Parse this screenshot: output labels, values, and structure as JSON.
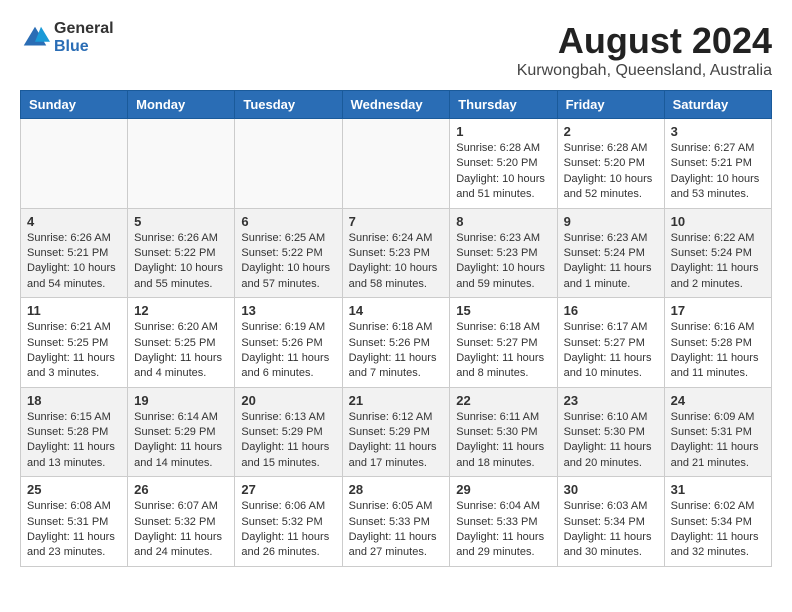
{
  "header": {
    "logo_general": "General",
    "logo_blue": "Blue",
    "main_title": "August 2024",
    "subtitle": "Kurwongbah, Queensland, Australia"
  },
  "days_of_week": [
    "Sunday",
    "Monday",
    "Tuesday",
    "Wednesday",
    "Thursday",
    "Friday",
    "Saturday"
  ],
  "weeks": [
    {
      "shade": false,
      "days": [
        {
          "num": "",
          "info": ""
        },
        {
          "num": "",
          "info": ""
        },
        {
          "num": "",
          "info": ""
        },
        {
          "num": "",
          "info": ""
        },
        {
          "num": "1",
          "info": "Sunrise: 6:28 AM\nSunset: 5:20 PM\nDaylight: 10 hours\nand 51 minutes."
        },
        {
          "num": "2",
          "info": "Sunrise: 6:28 AM\nSunset: 5:20 PM\nDaylight: 10 hours\nand 52 minutes."
        },
        {
          "num": "3",
          "info": "Sunrise: 6:27 AM\nSunset: 5:21 PM\nDaylight: 10 hours\nand 53 minutes."
        }
      ]
    },
    {
      "shade": true,
      "days": [
        {
          "num": "4",
          "info": "Sunrise: 6:26 AM\nSunset: 5:21 PM\nDaylight: 10 hours\nand 54 minutes."
        },
        {
          "num": "5",
          "info": "Sunrise: 6:26 AM\nSunset: 5:22 PM\nDaylight: 10 hours\nand 55 minutes."
        },
        {
          "num": "6",
          "info": "Sunrise: 6:25 AM\nSunset: 5:22 PM\nDaylight: 10 hours\nand 57 minutes."
        },
        {
          "num": "7",
          "info": "Sunrise: 6:24 AM\nSunset: 5:23 PM\nDaylight: 10 hours\nand 58 minutes."
        },
        {
          "num": "8",
          "info": "Sunrise: 6:23 AM\nSunset: 5:23 PM\nDaylight: 10 hours\nand 59 minutes."
        },
        {
          "num": "9",
          "info": "Sunrise: 6:23 AM\nSunset: 5:24 PM\nDaylight: 11 hours\nand 1 minute."
        },
        {
          "num": "10",
          "info": "Sunrise: 6:22 AM\nSunset: 5:24 PM\nDaylight: 11 hours\nand 2 minutes."
        }
      ]
    },
    {
      "shade": false,
      "days": [
        {
          "num": "11",
          "info": "Sunrise: 6:21 AM\nSunset: 5:25 PM\nDaylight: 11 hours\nand 3 minutes."
        },
        {
          "num": "12",
          "info": "Sunrise: 6:20 AM\nSunset: 5:25 PM\nDaylight: 11 hours\nand 4 minutes."
        },
        {
          "num": "13",
          "info": "Sunrise: 6:19 AM\nSunset: 5:26 PM\nDaylight: 11 hours\nand 6 minutes."
        },
        {
          "num": "14",
          "info": "Sunrise: 6:18 AM\nSunset: 5:26 PM\nDaylight: 11 hours\nand 7 minutes."
        },
        {
          "num": "15",
          "info": "Sunrise: 6:18 AM\nSunset: 5:27 PM\nDaylight: 11 hours\nand 8 minutes."
        },
        {
          "num": "16",
          "info": "Sunrise: 6:17 AM\nSunset: 5:27 PM\nDaylight: 11 hours\nand 10 minutes."
        },
        {
          "num": "17",
          "info": "Sunrise: 6:16 AM\nSunset: 5:28 PM\nDaylight: 11 hours\nand 11 minutes."
        }
      ]
    },
    {
      "shade": true,
      "days": [
        {
          "num": "18",
          "info": "Sunrise: 6:15 AM\nSunset: 5:28 PM\nDaylight: 11 hours\nand 13 minutes."
        },
        {
          "num": "19",
          "info": "Sunrise: 6:14 AM\nSunset: 5:29 PM\nDaylight: 11 hours\nand 14 minutes."
        },
        {
          "num": "20",
          "info": "Sunrise: 6:13 AM\nSunset: 5:29 PM\nDaylight: 11 hours\nand 15 minutes."
        },
        {
          "num": "21",
          "info": "Sunrise: 6:12 AM\nSunset: 5:29 PM\nDaylight: 11 hours\nand 17 minutes."
        },
        {
          "num": "22",
          "info": "Sunrise: 6:11 AM\nSunset: 5:30 PM\nDaylight: 11 hours\nand 18 minutes."
        },
        {
          "num": "23",
          "info": "Sunrise: 6:10 AM\nSunset: 5:30 PM\nDaylight: 11 hours\nand 20 minutes."
        },
        {
          "num": "24",
          "info": "Sunrise: 6:09 AM\nSunset: 5:31 PM\nDaylight: 11 hours\nand 21 minutes."
        }
      ]
    },
    {
      "shade": false,
      "days": [
        {
          "num": "25",
          "info": "Sunrise: 6:08 AM\nSunset: 5:31 PM\nDaylight: 11 hours\nand 23 minutes."
        },
        {
          "num": "26",
          "info": "Sunrise: 6:07 AM\nSunset: 5:32 PM\nDaylight: 11 hours\nand 24 minutes."
        },
        {
          "num": "27",
          "info": "Sunrise: 6:06 AM\nSunset: 5:32 PM\nDaylight: 11 hours\nand 26 minutes."
        },
        {
          "num": "28",
          "info": "Sunrise: 6:05 AM\nSunset: 5:33 PM\nDaylight: 11 hours\nand 27 minutes."
        },
        {
          "num": "29",
          "info": "Sunrise: 6:04 AM\nSunset: 5:33 PM\nDaylight: 11 hours\nand 29 minutes."
        },
        {
          "num": "30",
          "info": "Sunrise: 6:03 AM\nSunset: 5:34 PM\nDaylight: 11 hours\nand 30 minutes."
        },
        {
          "num": "31",
          "info": "Sunrise: 6:02 AM\nSunset: 5:34 PM\nDaylight: 11 hours\nand 32 minutes."
        }
      ]
    }
  ]
}
